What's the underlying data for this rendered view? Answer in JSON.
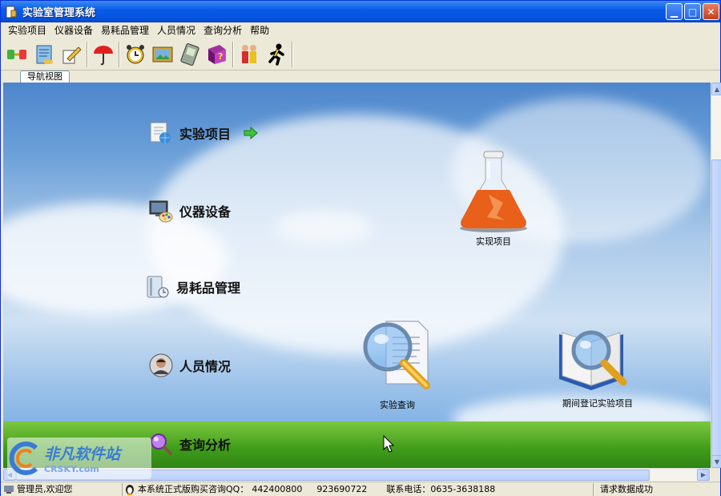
{
  "window": {
    "title": "实验室管理系统",
    "controls": {
      "minimize": "▁",
      "maximize": "□",
      "close": "✕"
    }
  },
  "menu": [
    "实验项目",
    "仪器设备",
    "易耗品管理",
    "人员情况",
    "查询分析",
    "帮助"
  ],
  "toolbar": {
    "buttons": [
      "connect-icon",
      "book-icon",
      "pen-icon",
      "umbrella-icon",
      "alarm-clock-icon",
      "picture-icon",
      "handheld-icon",
      "help-book-icon",
      "people-icon",
      "runner-icon"
    ]
  },
  "tab": {
    "label": "导航视图"
  },
  "nav": {
    "items": [
      {
        "label": "实验项目",
        "icon": "document-globe-icon"
      },
      {
        "label": "仪器设备",
        "icon": "monitor-palette-icon"
      },
      {
        "label": "易耗品管理",
        "icon": "clipboard-clock-icon"
      },
      {
        "label": "人员情况",
        "icon": "person-photo-icon"
      },
      {
        "label": "查询分析",
        "icon": "magnifier-icon"
      }
    ],
    "arrow_icon": "green-arrow-icon"
  },
  "icons": {
    "flask": {
      "caption": "实现项目"
    },
    "query": {
      "caption": "实验查询"
    },
    "period": {
      "caption": "期间登记实验项目"
    }
  },
  "watermark": {
    "brand": "非凡软件站",
    "site": "CRSKY.com"
  },
  "status": {
    "user": "管理员,欢迎您",
    "qq_label": "本系统正式版购买咨询QQ：",
    "qq1": "442400800",
    "qq2": "923690722",
    "phone": "联系电话：0635-3638188",
    "state": "请求数据成功"
  },
  "colors": {
    "titlebar": "#0a5ce6",
    "menu_bg": "#ece9d8",
    "grass": "#3f9c1a"
  }
}
